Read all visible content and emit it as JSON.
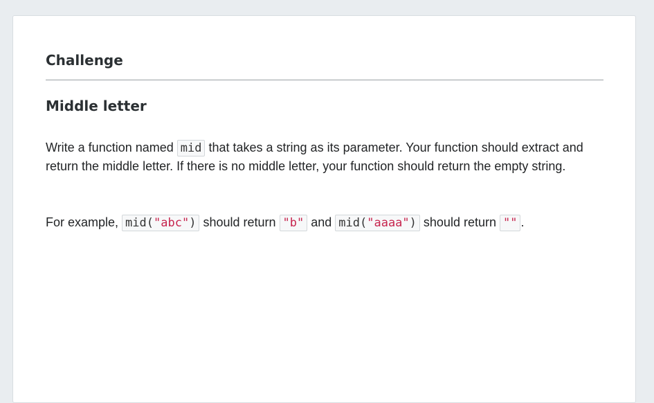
{
  "page": {
    "heading": "Challenge",
    "subheading": "Middle letter"
  },
  "description": {
    "text_before_code": "Write a function named ",
    "code_function": "mid",
    "text_after_code": " that takes a string as its parameter. Your function should extract and return the middle letter. If there is no middle letter, your function should return the empty string."
  },
  "example": {
    "intro": "For example, ",
    "call1_prefix": "mid(",
    "call1_arg": "\"abc\"",
    "call1_suffix": ")",
    "connector1": " should return ",
    "result1": "\"b\"",
    "connector2": " and ",
    "call2_prefix": "mid(",
    "call2_arg": "\"aaaa\"",
    "call2_suffix": ")",
    "connector3": " should return ",
    "result2": "\"\"",
    "end": "."
  },
  "colors": {
    "page_background": "#e9edf0",
    "card_background": "#ffffff",
    "string_literal": "#c7254e"
  }
}
